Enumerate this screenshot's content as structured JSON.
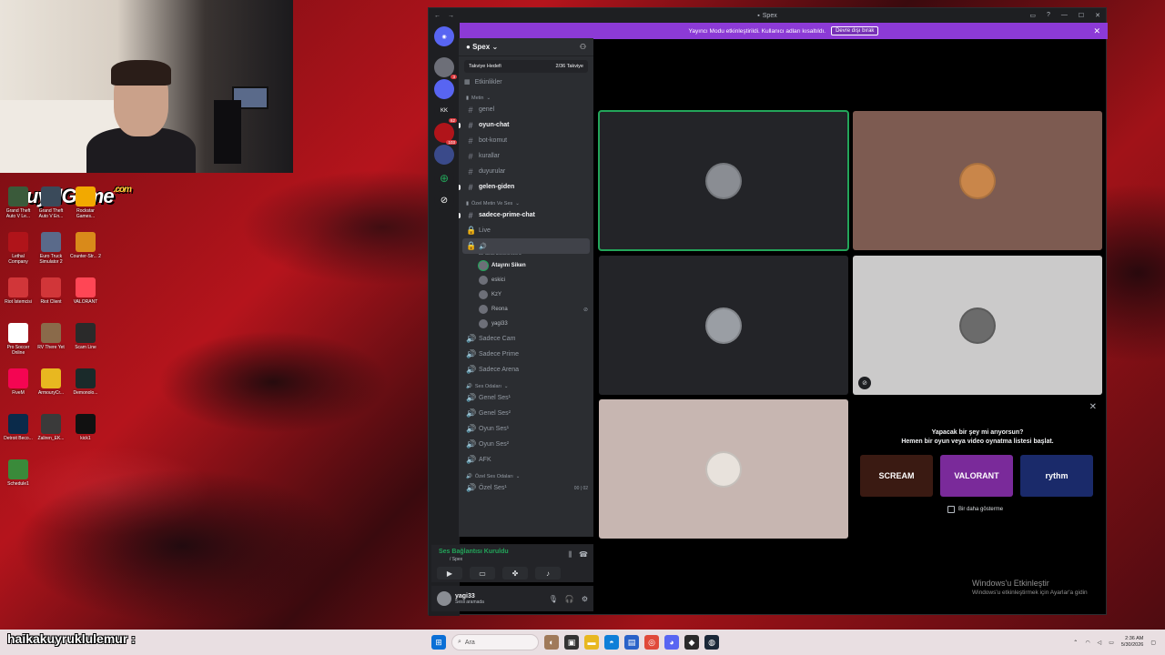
{
  "overlay": {
    "logo_text": "BuyNGame",
    "logo_suffix": ".com",
    "scroll_text": "haikakuyruklulemur :"
  },
  "desktop_icons": [
    {
      "label": "Grand Theft Auto V Le...",
      "color": "#3a5a3a"
    },
    {
      "label": "Grand Theft Auto V En...",
      "color": "#3a4a5a"
    },
    {
      "label": "Rockstar Games...",
      "color": "#f2a900"
    },
    {
      "label": "Lethal Company",
      "color": "#b0141a"
    },
    {
      "label": "Euro Truck Simulator 2",
      "color": "#5a6a8a"
    },
    {
      "label": "Counter-Str... 2",
      "color": "#d98a1a"
    },
    {
      "label": "Riot İstemcisi",
      "color": "#d13639"
    },
    {
      "label": "Riot Client",
      "color": "#d13639"
    },
    {
      "label": "VALORANT",
      "color": "#ff4655"
    },
    {
      "label": "Pro Soccer Online",
      "color": "#ffffff"
    },
    {
      "label": "RV There Yet",
      "color": "#8a6a4a"
    },
    {
      "label": "Scam Line",
      "color": "#2a2a2a"
    },
    {
      "label": "FiveM",
      "color": "#f40552"
    },
    {
      "label": "ArmouryCr...",
      "color": "#e8b820"
    },
    {
      "label": "Demonolo...",
      "color": "#1a2a2a"
    },
    {
      "label": "Detroit Beco...",
      "color": "#0a2a4a"
    },
    {
      "label": "Zaliren_EK...",
      "color": "#3a3a3a"
    },
    {
      "label": "kick1",
      "color": "#111111"
    },
    {
      "label": "Schedule1",
      "color": "#3a8a3a"
    }
  ],
  "window": {
    "title": "Spex",
    "banner_text": "Yayıncı Modu etkinleştirildi. Kullanıcı adları kısaltıldı.",
    "banner_button": "Devre dışı bırak"
  },
  "guilds": [
    {
      "label": "",
      "badge": "3",
      "color": "#6d6f78"
    },
    {
      "label": "",
      "badge": "",
      "color": "#5865f2"
    },
    {
      "label": "KK",
      "badge": "62",
      "color": "#1e1f22"
    },
    {
      "label": "",
      "badge": "103",
      "color": "#b0141a"
    },
    {
      "label": "",
      "badge": "",
      "color": "#3a4a8a"
    }
  ],
  "server": {
    "name": "Spex",
    "boost_label": "Takviye Hedefi",
    "boost_value": "2/36 Takviye",
    "events_label": "Etkinlikler"
  },
  "categories": {
    "text": "Metin",
    "private_text_voice": "Özel Metin Ve Ses",
    "voice_rooms": "Ses Odaları",
    "private_voice_rooms": "Özel Ses Odaları"
  },
  "text_channels": [
    {
      "name": "genel",
      "unread": false
    },
    {
      "name": "oyun-chat",
      "unread": true
    },
    {
      "name": "bot-komut",
      "unread": false
    },
    {
      "name": "kurallar",
      "unread": false
    },
    {
      "name": "duyurular",
      "unread": false
    },
    {
      "name": "gelen-giden",
      "unread": true
    }
  ],
  "private_channels": {
    "prime_chat": "sadece-prime-chat",
    "live": "Live",
    "status_hint": "Bir kanal durumu belirle"
  },
  "voice_users": [
    {
      "name": "Atayını Siken",
      "speaking": true,
      "muted": false
    },
    {
      "name": "eskici",
      "speaking": false,
      "muted": false
    },
    {
      "name": "KzY",
      "speaking": false,
      "muted": false
    },
    {
      "name": "Reona",
      "speaking": false,
      "muted": true
    },
    {
      "name": "yagi33",
      "speaking": false,
      "muted": false
    }
  ],
  "voice_channels_a": [
    "Sadece Cam",
    "Sadece Prime",
    "Sadece Arena"
  ],
  "voice_channels_b": [
    "Genel Ses¹",
    "Genel Ses²",
    "Oyun Ses¹",
    "Oyun Ses²",
    "AFK"
  ],
  "private_voice": {
    "name": "Özel Ses¹",
    "count": "00",
    "limit": "02"
  },
  "voice_connection": {
    "status": "Ses Bağlantısı Kuruldu",
    "channel": "/ Spex"
  },
  "user": {
    "name": "yagi33",
    "status": "Sesli aramada"
  },
  "tiles": [
    {
      "bg": "#232428",
      "pfp": "#8a8d93",
      "speaking": true,
      "muted": false
    },
    {
      "bg": "#7d5b51",
      "pfp": "#c9864a",
      "speaking": false,
      "muted": false
    },
    {
      "bg": "#232428",
      "pfp": "#9a9ea4",
      "speaking": false,
      "muted": false
    },
    {
      "bg": "#cbcaca",
      "pfp": "#6b6b6b",
      "speaking": false,
      "muted": true
    },
    {
      "bg": "#c7b6b1",
      "pfp": "#e8e2dc",
      "speaking": false,
      "muted": false
    }
  ],
  "activity": {
    "question": "Yapacak bir şey mi arıyorsun?",
    "prompt": "Hemen bir oyun veya video oynatma listesi başlat.",
    "cards": [
      {
        "label": "SCREAM",
        "color": "#3a1a12"
      },
      {
        "label": "VALORANT",
        "color": "#7a2a9a"
      },
      {
        "label": "rythm",
        "color": "#1a2a6a"
      }
    ],
    "dont_show": "Bir daha gösterme"
  },
  "windows_activation": {
    "title": "Windows'u Etkinleştir",
    "subtitle": "Windows'u etkinleştirmek için Ayarlar'a gidin"
  },
  "taskbar": {
    "search_placeholder": "Ara",
    "time": "2:36 AM",
    "date": "5/30/2026"
  }
}
